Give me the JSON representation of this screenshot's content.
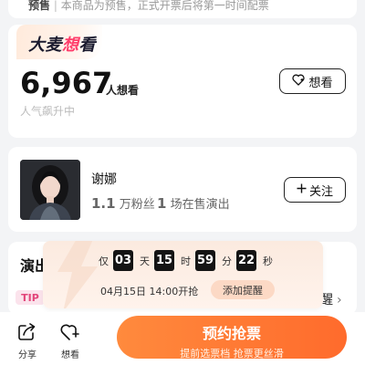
{
  "notice": {
    "tag": "预售",
    "text": "本商品为预售，正式开票后将第一时间配票"
  },
  "want": {
    "logo_text_left": "大麦",
    "logo_text_accent": "想",
    "logo_text_right": "看",
    "count": "6,967",
    "unit": "人想看",
    "rank_text": "人气飙升中",
    "button_label": "想看"
  },
  "artist": {
    "name": "谢娜",
    "fans_num": "1.1",
    "fans_label": "万粉丝",
    "shows_num": "1",
    "shows_label": "场在售演出",
    "follow_label": "关注"
  },
  "show": {
    "title_visible": "演出",
    "tip_badge": "TIP",
    "remind_partial": "醒"
  },
  "countdown": {
    "prefix": "仅",
    "days": "03",
    "days_unit": "天",
    "hours": "15",
    "hours_unit": "时",
    "minutes": "59",
    "minutes_unit": "分",
    "seconds": "22",
    "seconds_unit": "秒",
    "start_text": "04月15日 14:00开抢",
    "remind_label": "添加提醒"
  },
  "bottom": {
    "share_label": "分享",
    "want_label": "想看",
    "reserve_title": "预约抢票",
    "reserve_sub": "提前选票档 抢票更丝滑"
  },
  "colors": {
    "brand_orange": "#ff6b2c",
    "brand_pink": "#ff3d6b",
    "countdown_bg": "#fbeadf"
  },
  "icons": {
    "heart_plus": "heart-plus-icon",
    "share": "share-icon",
    "plus": "plus-icon",
    "chevron": "chevron-right-icon"
  }
}
